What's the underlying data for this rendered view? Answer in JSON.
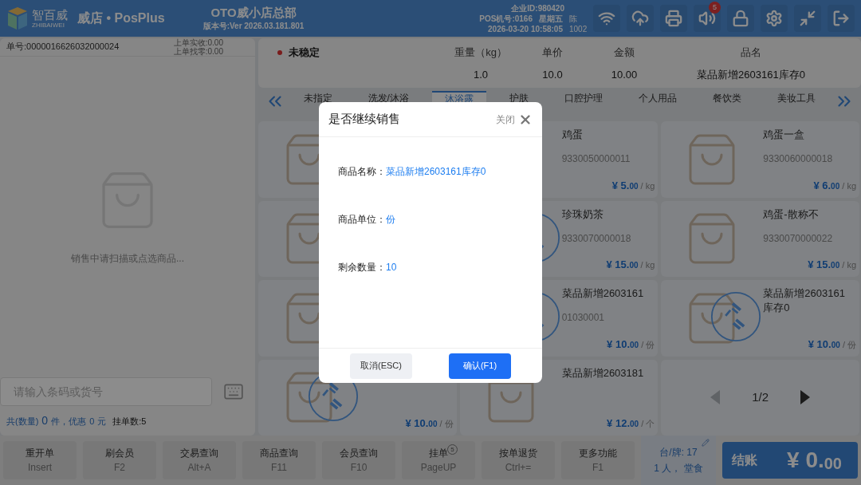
{
  "header": {
    "logo_text": "智百威",
    "logo_subtext": "ZHIBAIWEI",
    "app_name": "威店 • PosPlus",
    "store": "OTO威小店总部",
    "version": "版本号:Ver 2026.03.181.801",
    "company_id": "企业ID:980420",
    "pos_no": "POS机号:0166",
    "weekday": "星期五",
    "operator_name": "陈",
    "datetime": "2026-03-20 10:58:05",
    "operator_id": "1002",
    "volume_badge": "5"
  },
  "order": {
    "number": "单号:0000016626032000024",
    "last_paid": "上单实收:0.00",
    "last_change": "上单找零:0.00",
    "empty_hint": "销售中请扫描或点选商品...",
    "barcode_placeholder": "请输入条码或货号",
    "count_label": "共(数量)",
    "count": "0",
    "discount_label": "件，优惠",
    "discount": "0",
    "discount_unit": "元",
    "held": "挂单数:5"
  },
  "scale": {
    "status": "未稳定",
    "stable": false,
    "columns": [
      {
        "label": "重量（kg）",
        "value": "1.0"
      },
      {
        "label": "单价",
        "value": "10.0"
      },
      {
        "label": "金额",
        "value": "10.00"
      },
      {
        "label": "品名",
        "value": "菜品新增2603161库存0"
      }
    ]
  },
  "tabs": [
    {
      "label": "未指定",
      "selected": false
    },
    {
      "label": "洗发/沐浴",
      "selected": false
    },
    {
      "label": "沐浴露",
      "selected": true
    },
    {
      "label": "护肤",
      "selected": false
    },
    {
      "label": "口腔护理",
      "selected": false
    },
    {
      "label": "个人用品",
      "selected": false
    },
    {
      "label": "餐饮类",
      "selected": false
    },
    {
      "label": "美妆工具",
      "selected": false
    }
  ],
  "products": [
    {
      "kind": "product",
      "bag": true,
      "sold_out": false
    },
    {
      "kind": "product",
      "name": "鸡蛋",
      "code": "9330050000011",
      "price": "¥ 5.",
      "cents": "00",
      "unit": "/ kg",
      "sold_out": false
    },
    {
      "kind": "product",
      "bag": true,
      "name": "鸡蛋一盒",
      "code": "9330060000018",
      "price": "¥ 6.",
      "cents": "00",
      "unit": "/ kg",
      "sold_out": false
    },
    {
      "kind": "product",
      "bag": true,
      "sold_out": false
    },
    {
      "kind": "product",
      "name": "珍珠奶茶",
      "code": "9330070000018",
      "price": "¥ 15.",
      "cents": "00",
      "unit": "/ kg",
      "sold_out": true
    },
    {
      "kind": "product",
      "bag": true,
      "name": "鸡蛋-散称不",
      "code": "9330070000022",
      "price": "¥ 15.",
      "cents": "00",
      "unit": "/ kg",
      "sold_out": false
    },
    {
      "kind": "product",
      "bag": true,
      "sold_out": false
    },
    {
      "kind": "product",
      "name": "菜品新增2603161",
      "code": "01030001",
      "price": "¥ 10.",
      "cents": "00",
      "unit": "/ 份",
      "sold_out": true
    },
    {
      "kind": "product",
      "bag": true,
      "name": "菜品新增2603161库存0",
      "price": "¥ 10.",
      "cents": "00",
      "unit": "/ 份",
      "sold_out": true
    },
    {
      "kind": "product",
      "bag": true,
      "price": "¥ 10.",
      "cents": "00",
      "unit": "/ 份",
      "sold_out": true
    },
    {
      "kind": "product",
      "bag": true,
      "name": "菜品新增2603181",
      "price": "¥ 12.",
      "cents": "00",
      "unit": "/ 个",
      "sold_out": false
    },
    {
      "kind": "pager",
      "page": "1/2"
    }
  ],
  "toolbar": [
    {
      "label": "重开单",
      "key": "Insert"
    },
    {
      "label": "刷会员",
      "key": "F2"
    },
    {
      "label": "交易查询",
      "key": "Alt+A"
    },
    {
      "label": "商品查询",
      "key": "F11"
    },
    {
      "label": "会员查询",
      "key": "F10"
    },
    {
      "label": "挂单",
      "key": "PageUP",
      "badge": "5"
    },
    {
      "label": "按单退货",
      "key": "Ctrl+="
    },
    {
      "label": "更多功能",
      "key": "F1"
    }
  ],
  "table": {
    "number": "台/牌: 17",
    "guests": "1 人， 堂食"
  },
  "checkout": {
    "label": "结账",
    "amount": "¥ 0.",
    "cents": "00"
  },
  "dialog": {
    "title": "是否继续销售",
    "close": "关闭",
    "fields": [
      {
        "label": "商品名称：",
        "value": "菜品新增2603161库存0"
      },
      {
        "label": "商品单位：",
        "value": "份"
      },
      {
        "label": "剩余数量：",
        "value": "10"
      }
    ],
    "cancel": "取消(ESC)",
    "confirm": "确认(F1)"
  }
}
